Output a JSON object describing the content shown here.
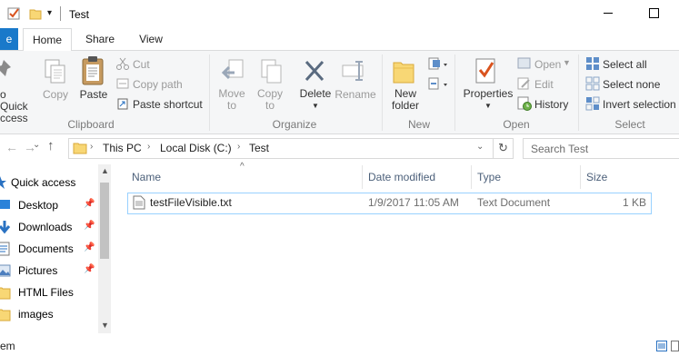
{
  "window": {
    "title": "Test"
  },
  "tabs": {
    "file": "e",
    "home": "Home",
    "share": "Share",
    "view": "View"
  },
  "ribbon": {
    "clipboard": {
      "pin_line1": "o Quick",
      "pin_line2": "ccess",
      "copy": "Copy",
      "paste": "Paste",
      "cut": "Cut",
      "copy_path": "Copy path",
      "paste_shortcut": "Paste shortcut",
      "label": "Clipboard"
    },
    "organize": {
      "move_to_line1": "Move",
      "move_to_line2": "to",
      "copy_to_line1": "Copy",
      "copy_to_line2": "to",
      "delete": "Delete",
      "rename": "Rename",
      "label": "Organize"
    },
    "new": {
      "new_folder_line1": "New",
      "new_folder_line2": "folder",
      "label": "New"
    },
    "open": {
      "properties": "Properties",
      "open": "Open",
      "edit": "Edit",
      "history": "History",
      "label": "Open"
    },
    "select": {
      "select_all": "Select all",
      "select_none": "Select none",
      "invert_selection": "Invert selection",
      "label": "Select"
    }
  },
  "address": {
    "crumbs": [
      "This PC",
      "Local Disk (C:)",
      "Test"
    ],
    "search_placeholder": "Search Test"
  },
  "nav": {
    "items": [
      {
        "label": "Quick access",
        "icon": "star-icon"
      },
      {
        "label": "Desktop",
        "icon": "desktop-icon",
        "pinned": true
      },
      {
        "label": "Downloads",
        "icon": "download-icon",
        "pinned": true
      },
      {
        "label": "Documents",
        "icon": "documents-icon",
        "pinned": true
      },
      {
        "label": "Pictures",
        "icon": "pictures-icon",
        "pinned": true
      },
      {
        "label": "HTML Files",
        "icon": "folder-icon"
      },
      {
        "label": "images",
        "icon": "folder-icon"
      }
    ]
  },
  "columns": {
    "name": "Name",
    "date": "Date modified",
    "type": "Type",
    "size": "Size"
  },
  "files": [
    {
      "name": "testFileVisible.txt",
      "date": "1/9/2017 11:05 AM",
      "type": "Text Document",
      "size": "1 KB"
    }
  ],
  "status": {
    "left": "em"
  },
  "colors": {
    "accent": "#1979ca",
    "folder": "#f8d775",
    "selection_border": "#99d1ff",
    "header_text": "#4c607a"
  }
}
